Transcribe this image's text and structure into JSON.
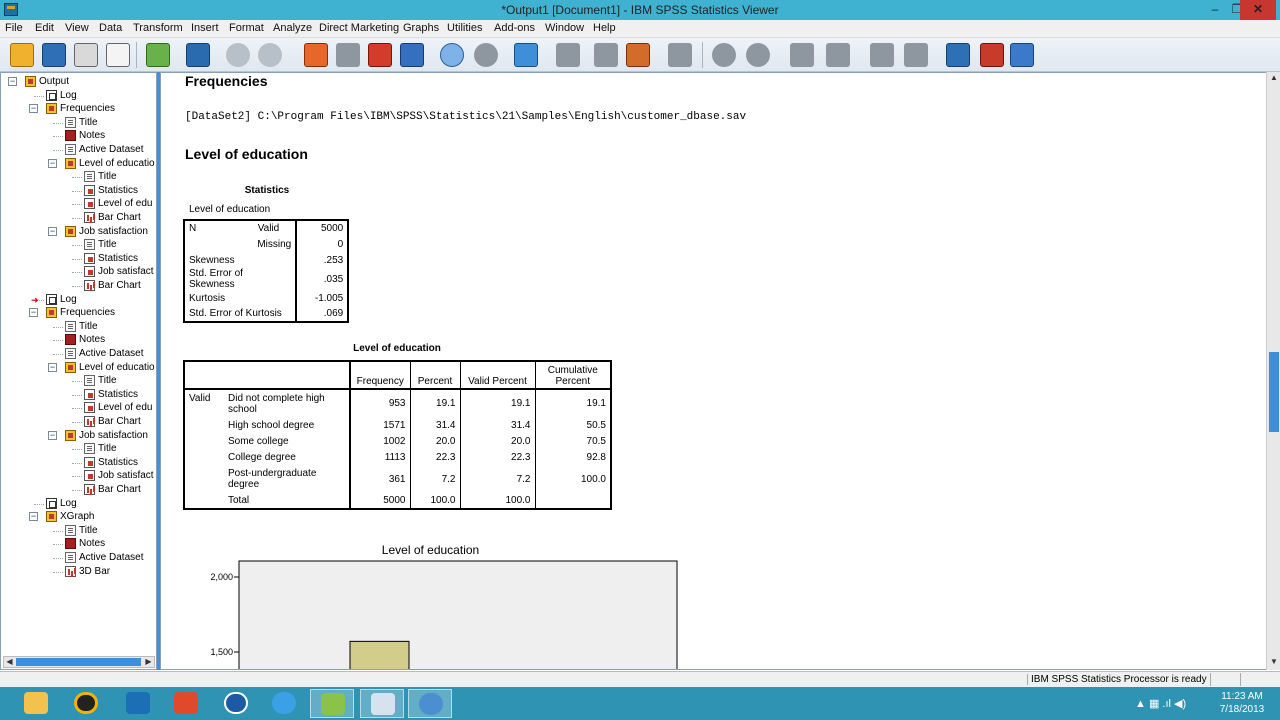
{
  "window": {
    "title": "*Output1 [Document1] - IBM SPSS Statistics Viewer",
    "min": "–",
    "max": "❐",
    "close": "✕"
  },
  "menu": [
    "File",
    "Edit",
    "View",
    "Data",
    "Transform",
    "Insert",
    "Format",
    "Analyze",
    "Direct Marketing",
    "Graphs",
    "Utilities",
    "Add-ons",
    "Window",
    "Help"
  ],
  "tree": {
    "root": "Output",
    "nodes": [
      {
        "label": "Log"
      },
      {
        "label": "Frequencies"
      },
      {
        "label": "Title"
      },
      {
        "label": "Notes"
      },
      {
        "label": "Active Dataset"
      },
      {
        "label": "Level of educatio"
      },
      {
        "label": "Title"
      },
      {
        "label": "Statistics"
      },
      {
        "label": "Level of edu"
      },
      {
        "label": "Bar Chart"
      },
      {
        "label": "Job satisfaction"
      },
      {
        "label": "Title"
      },
      {
        "label": "Statistics"
      },
      {
        "label": "Job satisfact"
      },
      {
        "label": "Bar Chart"
      },
      {
        "label": "Log"
      },
      {
        "label": "Frequencies"
      },
      {
        "label": "Title"
      },
      {
        "label": "Notes"
      },
      {
        "label": "Active Dataset"
      },
      {
        "label": "Level of educatio"
      },
      {
        "label": "Title"
      },
      {
        "label": "Statistics"
      },
      {
        "label": "Level of edu"
      },
      {
        "label": "Bar Chart"
      },
      {
        "label": "Job satisfaction"
      },
      {
        "label": "Title"
      },
      {
        "label": "Statistics"
      },
      {
        "label": "Job satisfact"
      },
      {
        "label": "Bar Chart"
      },
      {
        "label": "Log"
      },
      {
        "label": "XGraph"
      },
      {
        "label": "Title"
      },
      {
        "label": "Notes"
      },
      {
        "label": "Active Dataset"
      },
      {
        "label": "3D Bar"
      }
    ]
  },
  "output": {
    "heading": "Frequencies",
    "dataset_path": "[DataSet2] C:\\Program Files\\IBM\\SPSS\\Statistics\\21\\Samples\\English\\customer_dbase.sav",
    "section_heading": "Level of education",
    "stats_table": {
      "caption": "Statistics",
      "subtitle": "Level of education",
      "n_label": "N",
      "valid_label": "Valid",
      "valid_value": "5000",
      "missing_label": "Missing",
      "missing_value": "0",
      "rows": [
        {
          "label": "Skewness",
          "value": ".253"
        },
        {
          "label": "Std. Error of Skewness",
          "value": ".035"
        },
        {
          "label": "Kurtosis",
          "value": "-1.005"
        },
        {
          "label": "Std. Error of Kurtosis",
          "value": ".069"
        }
      ]
    },
    "freq_table": {
      "caption": "Level of education",
      "headers": [
        "Frequency",
        "Percent",
        "Valid Percent",
        "Cumulative Percent"
      ],
      "group_label": "Valid",
      "rows": [
        {
          "label": "Did not complete high school",
          "freq": "953",
          "pct": "19.1",
          "vpct": "19.1",
          "cum": "19.1"
        },
        {
          "label": "High school degree",
          "freq": "1571",
          "pct": "31.4",
          "vpct": "31.4",
          "cum": "50.5"
        },
        {
          "label": "Some college",
          "freq": "1002",
          "pct": "20.0",
          "vpct": "20.0",
          "cum": "70.5"
        },
        {
          "label": "College degree",
          "freq": "1113",
          "pct": "22.3",
          "vpct": "22.3",
          "cum": "92.8"
        },
        {
          "label": "Post-undergraduate degree",
          "freq": "361",
          "pct": "7.2",
          "vpct": "7.2",
          "cum": "100.0"
        },
        {
          "label": "Total",
          "freq": "5000",
          "pct": "100.0",
          "vpct": "100.0",
          "cum": ""
        }
      ]
    }
  },
  "chart_data": {
    "type": "bar",
    "title": "Level of education",
    "ticks": [
      2000,
      1500
    ],
    "tick_labels": [
      "2,000",
      "1,500"
    ],
    "visible_bars": [
      {
        "value": 1571
      }
    ],
    "bar_color": "#d3cd8b",
    "plot_bg": "#efefef"
  },
  "status": {
    "message": "IBM SPSS Statistics Processor is ready"
  },
  "taskbar": {
    "clock_time": "11:23 AM",
    "clock_date": "7/18/2013",
    "tray": "▲ ▦ .ıl ◀)"
  }
}
